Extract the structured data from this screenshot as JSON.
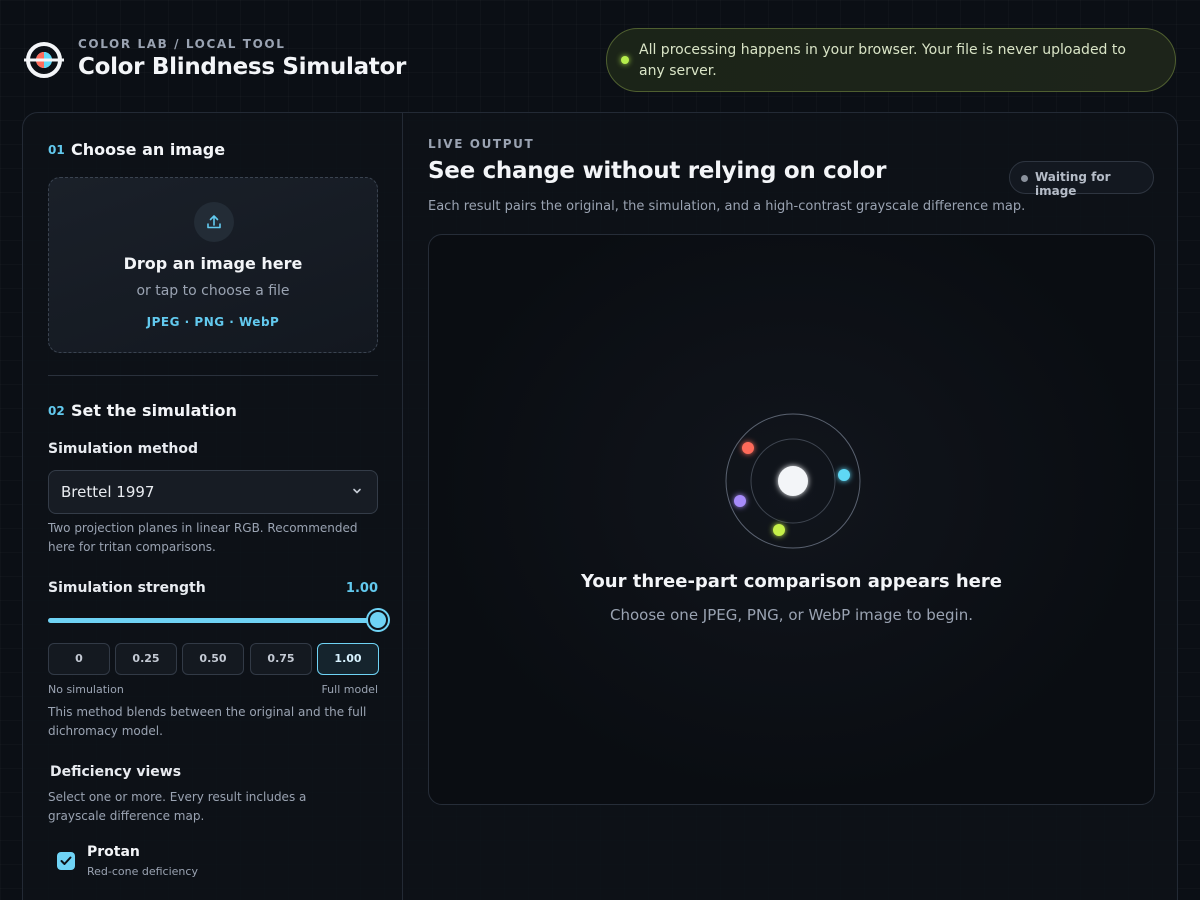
{
  "header": {
    "eyebrow": "COLOR LAB / LOCAL TOOL",
    "title": "Color Blindness Simulator",
    "privacy_note": "All processing happens in your browser. Your file is never uploaded to any server."
  },
  "step1": {
    "number": "01",
    "title": "Choose an image",
    "dropzone": {
      "title": "Drop an image here",
      "subtitle": "or tap to choose a file",
      "formats": "JPEG · PNG · WebP"
    }
  },
  "step2": {
    "number": "02",
    "title": "Set the simulation",
    "method": {
      "label": "Simulation method",
      "selected": "Brettel 1997",
      "help": "Two projection planes in linear RGB. Recommended here for tritan comparisons."
    },
    "strength": {
      "label": "Simulation strength",
      "value": 1.0,
      "value_label": "1.00",
      "presets": [
        "0",
        "0.25",
        "0.50",
        "0.75",
        "1.00"
      ],
      "active_preset": 4,
      "min_label": "No simulation",
      "max_label": "Full model",
      "help": "This method blends between the original and the full dichromacy model."
    },
    "deficiency": {
      "label": "Deficiency views",
      "help": "Select one or more. Every result includes a grayscale difference map.",
      "options": [
        {
          "title": "Protan",
          "subtitle": "Red-cone deficiency",
          "checked": true
        }
      ]
    }
  },
  "output": {
    "eyebrow": "LIVE OUTPUT",
    "title": "See change without relying on color",
    "subtitle": "Each result pairs the original, the simulation, and a high-contrast grayscale difference map.",
    "status": "Waiting for image",
    "empty_title": "Your three-part comparison appears here",
    "empty_subtitle": "Choose one JPEG, PNG, or WebP image to begin."
  },
  "colors": {
    "accent": "#6fd3f5",
    "privacy_dot": "#b6ee4c",
    "orbit_red": "#ff6b5a",
    "orbit_cyan": "#5fd8f5",
    "orbit_purple": "#a78bfa",
    "orbit_green": "#c5f04a"
  }
}
